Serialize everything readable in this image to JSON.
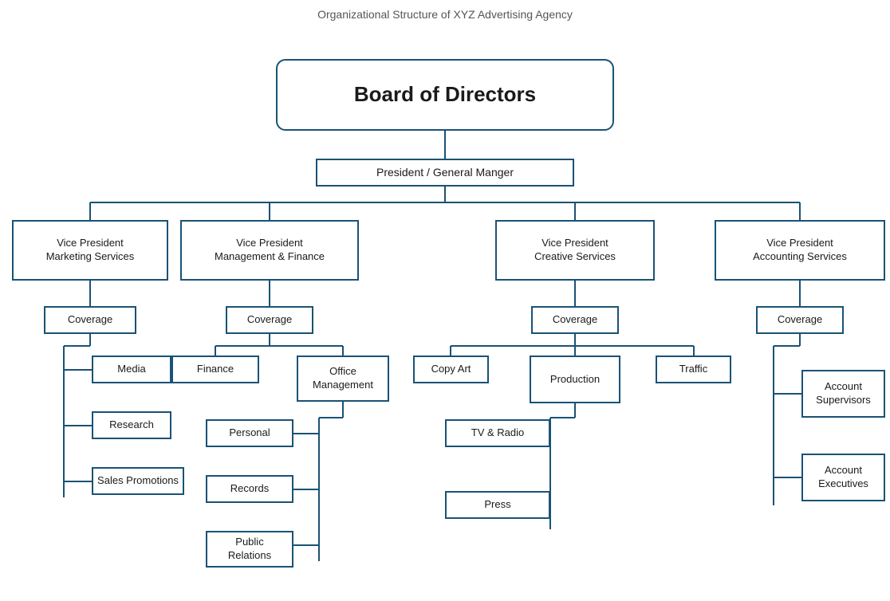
{
  "title": "Organizational Structure of XYZ Advertising Agency",
  "nodes": {
    "board": {
      "label": "Board of Directors"
    },
    "president": {
      "label": "President / General Manger"
    },
    "vp_marketing": {
      "label": "Vice President\nMarketing Services"
    },
    "vp_management": {
      "label": "Vice President\nManagement & Finance"
    },
    "vp_creative": {
      "label": "Vice President\nCreative Services"
    },
    "vp_accounting": {
      "label": "Vice President\nAccounting Services"
    },
    "coverage_marketing": {
      "label": "Coverage"
    },
    "coverage_management": {
      "label": "Coverage"
    },
    "coverage_creative": {
      "label": "Coverage"
    },
    "coverage_accounting": {
      "label": "Coverage"
    },
    "media": {
      "label": "Media"
    },
    "research": {
      "label": "Research"
    },
    "sales_promotions": {
      "label": "Sales Promotions"
    },
    "finance": {
      "label": "Finance"
    },
    "office_management": {
      "label": "Office\nManagement"
    },
    "personal": {
      "label": "Personal"
    },
    "records": {
      "label": "Records"
    },
    "public_relations": {
      "label": "Public\nRelations"
    },
    "copy_art": {
      "label": "Copy Art"
    },
    "production": {
      "label": "Production"
    },
    "traffic": {
      "label": "Traffic"
    },
    "tv_radio": {
      "label": "TV & Radio"
    },
    "press": {
      "label": "Press"
    },
    "account_supervisors": {
      "label": "Account\nSupervisors"
    },
    "account_executives": {
      "label": "Account\nExecutives"
    }
  }
}
